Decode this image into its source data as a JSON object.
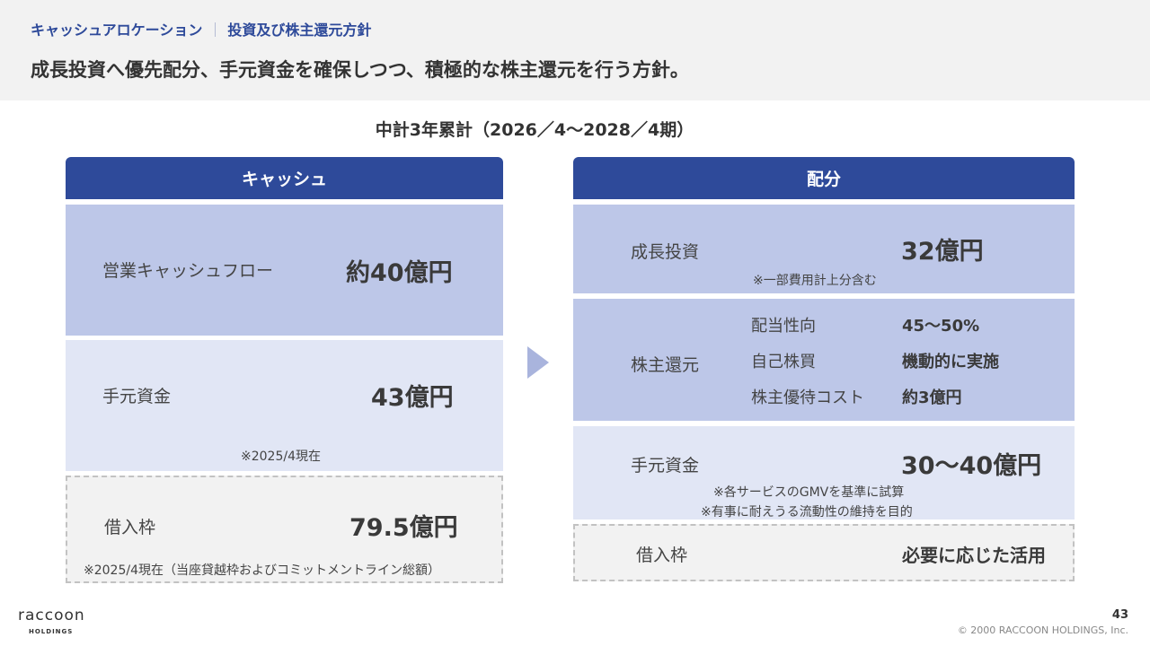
{
  "header": {
    "section": "キャッシュアロケーション",
    "separator": "｜",
    "subsection": "投資及び株主還元方針",
    "headline": "成長投資へ優先配分、手元資金を確保しつつ、積極的な株主還元を行う方針。"
  },
  "period": "中計3年累計（2026／4～2028／4期）",
  "cash": {
    "title": "キャッシュ",
    "operating": {
      "label": "営業キャッシュフロー",
      "value": "約40億円"
    },
    "on_hand": {
      "label": "手元資金",
      "value": "43億円",
      "note": "※2025/4現在"
    },
    "borrowing": {
      "label": "借入枠",
      "value": "79.5億円",
      "note": "※2025/4現在（当座貸越枠およびコミットメントライン総額）"
    }
  },
  "allocation": {
    "title": "配分",
    "growth": {
      "label": "成長投資",
      "value": "32億円",
      "note": "※一部費用計上分含む"
    },
    "shareholder": {
      "label": "株主還元",
      "items": [
        {
          "label": "配当性向",
          "value": "45～50%"
        },
        {
          "label": "自己株買",
          "value": "機動的に実施"
        },
        {
          "label": "株主優待コスト",
          "value": "約3億円"
        }
      ]
    },
    "on_hand": {
      "label": "手元資金",
      "value": "30～40億円",
      "note1": "※各サービスのGMVを基準に試算",
      "note2": "※有事に耐えうる流動性の維持を目的"
    },
    "borrowing": {
      "label": "借入枠",
      "value": "必要に応じた活用"
    }
  },
  "footer": {
    "logo": "raccoon",
    "logo_sub": "HOLDINGS",
    "page": "43",
    "copyright": "© 2000 RACCOON HOLDINGS, Inc."
  },
  "colors": {
    "primary": "#2e4a9a",
    "box_dark": "#bdc7e8",
    "box_light": "#e1e6f5",
    "box_gray": "#f2f2f2"
  }
}
